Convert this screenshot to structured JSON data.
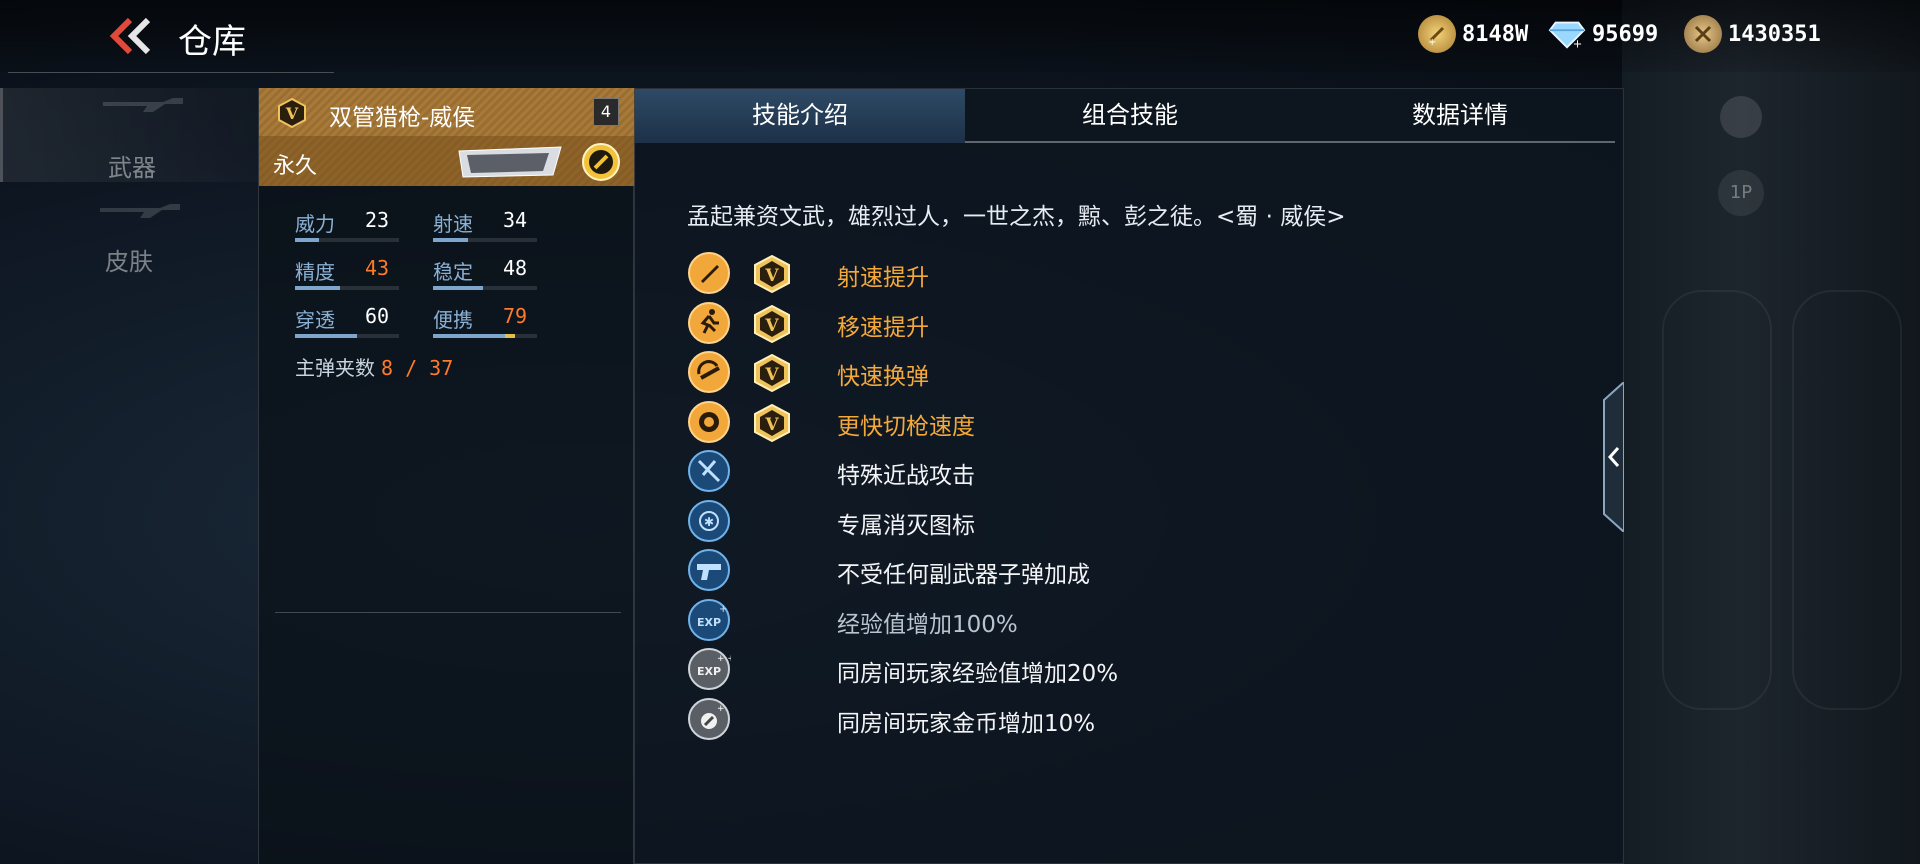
{
  "header": {
    "title": "仓库",
    "currencies": [
      {
        "icon": "gold-coin-plus-icon",
        "value": "8148W",
        "color": "#d8a94a"
      },
      {
        "icon": "diamond-plus-icon",
        "value": "95699",
        "color": "#8fd0ff"
      },
      {
        "icon": "honor-coin-icon",
        "value": "1430351",
        "color": "#c9a45e"
      }
    ]
  },
  "sidebar": {
    "items": [
      {
        "label": "武器",
        "icon": "rifle-silhouette-icon"
      },
      {
        "label": "皮肤",
        "icon": "rifle-silhouette-icon"
      }
    ]
  },
  "weapon": {
    "name": "双管猎枪-威侯",
    "level": "4",
    "duration": "永久",
    "logo_text": "威侯",
    "stats": [
      {
        "name": "威力",
        "value": "23",
        "fill": 0.23,
        "highlight": false
      },
      {
        "name": "射速",
        "value": "34",
        "fill": 0.34,
        "highlight": false
      },
      {
        "name": "精度",
        "value": "43",
        "fill": 0.43,
        "highlight": true
      },
      {
        "name": "稳定",
        "value": "48",
        "fill": 0.48,
        "highlight": false
      },
      {
        "name": "穿透",
        "value": "60",
        "fill": 0.6,
        "highlight": false
      },
      {
        "name": "便携",
        "value": "79",
        "fill": 0.79,
        "highlight": true
      }
    ],
    "ammo_label": "主弹夹数",
    "ammo_value": "8 / 37"
  },
  "tabs": [
    {
      "label": "技能介绍",
      "active": true
    },
    {
      "label": "组合技能",
      "active": false
    },
    {
      "label": "数据详情",
      "active": false
    }
  ],
  "description": "孟起兼资文武，雄烈过人，一世之杰，黥、彭之徒。<蜀 · 威侯>",
  "skills": [
    {
      "icon": "bullet-fire-rate-icon",
      "label": "射速提升",
      "v_badge": true,
      "style": "gold"
    },
    {
      "icon": "running-man-icon",
      "label": "移速提升",
      "v_badge": true,
      "style": "gold"
    },
    {
      "icon": "reload-magazine-icon",
      "label": "快速换弹",
      "v_badge": true,
      "style": "gold"
    },
    {
      "icon": "lion-head-icon",
      "label": "更快切枪速度",
      "v_badge": true,
      "style": "gold"
    },
    {
      "icon": "melee-knife-icon",
      "label": "特殊近战攻击",
      "v_badge": false,
      "style": "white"
    },
    {
      "icon": "kill-mark-icon",
      "label": "专属消灭图标",
      "v_badge": false,
      "style": "white"
    },
    {
      "icon": "pistol-icon",
      "label": "不受任何副武器子弹加成",
      "v_badge": false,
      "style": "white"
    },
    {
      "icon": "exp-boost-icon",
      "label": "经验值增加100%",
      "v_badge": false,
      "style": "dim"
    },
    {
      "icon": "room-exp-boost-icon",
      "label": "同房间玩家经验值增加20%",
      "v_badge": false,
      "style": "white"
    },
    {
      "icon": "room-gold-boost-icon",
      "label": "同房间玩家金币增加10%",
      "v_badge": false,
      "style": "white"
    }
  ],
  "colors": {
    "gold_text": "#f4a93a",
    "highlight_stat": "#ff7a2a",
    "stat_name": "#8ab0d4",
    "active_tab": "#2e4a66"
  }
}
